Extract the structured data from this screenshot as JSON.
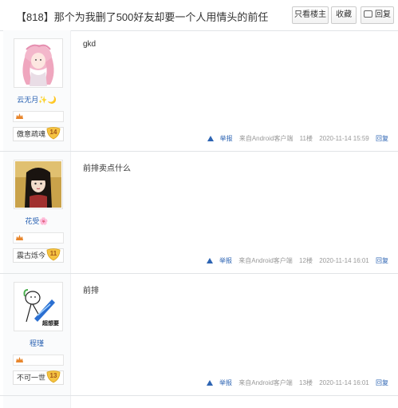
{
  "thread": {
    "title": "【818】那个为我删了500好友却要一个人用情头的前任"
  },
  "toolbar": {
    "only_op": "只看楼主",
    "favorite": "收藏",
    "reply": "回复"
  },
  "posts": [
    {
      "username": "云无月",
      "username_suffix": "✨🌙",
      "level_name": "傲意疏魂",
      "level": "14",
      "content": "gkd",
      "report": "举报",
      "source": "来自Android客户端",
      "floor": "11楼",
      "time": "2020-11-14 15:59",
      "reply": "回复"
    },
    {
      "username": "花受",
      "username_suffix": "🌸",
      "level_name": "震古烁今",
      "level": "11",
      "content": "前排卖点什么",
      "report": "举报",
      "source": "来自Android客户端",
      "floor": "12楼",
      "time": "2020-11-14 16:01",
      "reply": "回复"
    },
    {
      "username": "程瑾",
      "username_suffix": "",
      "level_name": "不可一世",
      "level": "13",
      "content": "前排",
      "report": "举报",
      "source": "来自Android客户端",
      "floor": "13楼",
      "time": "2020-11-14 16:01",
      "reply": "回复",
      "avatar_text": "超想要"
    }
  ],
  "colors": {
    "link": "#2d64b3",
    "meta": "#999999",
    "border": "#e1e4e6",
    "badge": "#f5c342"
  }
}
